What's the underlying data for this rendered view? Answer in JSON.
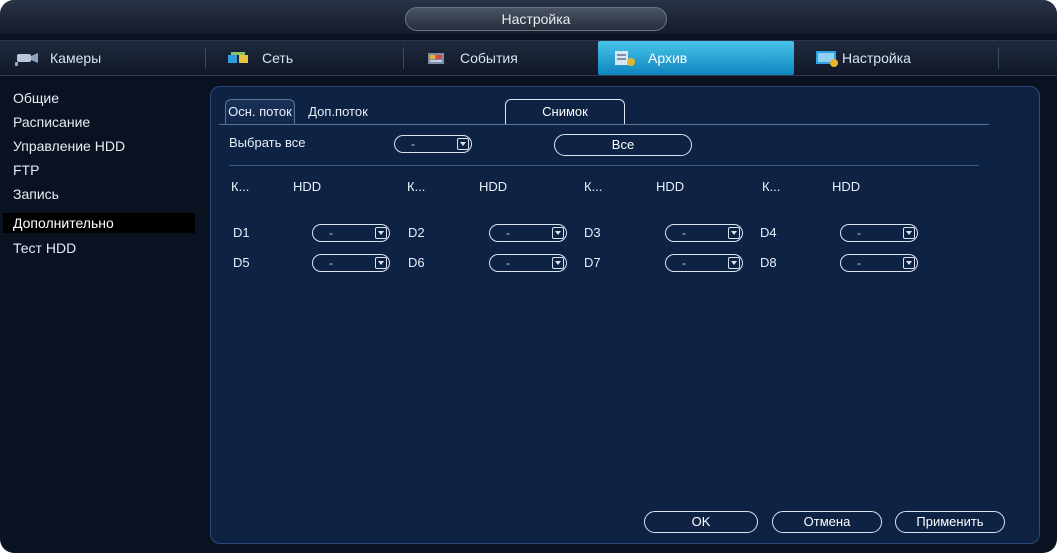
{
  "window": {
    "title": "Настройка"
  },
  "tabs": [
    {
      "label": "Камеры",
      "icon": "camera-icon"
    },
    {
      "label": "Сеть",
      "icon": "network-icon"
    },
    {
      "label": "События",
      "icon": "events-icon"
    },
    {
      "label": "Архив",
      "icon": "archive-icon",
      "active": true
    },
    {
      "label": "Настройка",
      "icon": "settings-icon"
    }
  ],
  "sidebar": {
    "items": [
      {
        "label": "Общие"
      },
      {
        "label": "Расписание"
      },
      {
        "label": "Управление HDD"
      },
      {
        "label": "FTP"
      },
      {
        "label": "Запись"
      },
      {
        "label": "Дополнительно",
        "active": true
      },
      {
        "label": "Тест HDD"
      }
    ]
  },
  "subtabs": [
    {
      "label": "Осн. поток"
    },
    {
      "label": "Доп.поток"
    },
    {
      "label": "Снимок",
      "active": true
    }
  ],
  "select_all": {
    "label": "Выбрать все",
    "value": "-",
    "button": "Все"
  },
  "columns": {
    "channel": "К...",
    "hdd": "HDD"
  },
  "channels": [
    {
      "name": "D1",
      "value": "-"
    },
    {
      "name": "D2",
      "value": "-"
    },
    {
      "name": "D3",
      "value": "-"
    },
    {
      "name": "D4",
      "value": "-"
    },
    {
      "name": "D5",
      "value": "-"
    },
    {
      "name": "D6",
      "value": "-"
    },
    {
      "name": "D7",
      "value": "-"
    },
    {
      "name": "D8",
      "value": "-"
    }
  ],
  "buttons": {
    "ok": "OK",
    "cancel": "Отмена",
    "apply": "Применить"
  },
  "colors": {
    "background": "#0a1120",
    "panel": "#0e2244",
    "accent": "#1fa6d8",
    "sidebar_active": "#000000"
  }
}
